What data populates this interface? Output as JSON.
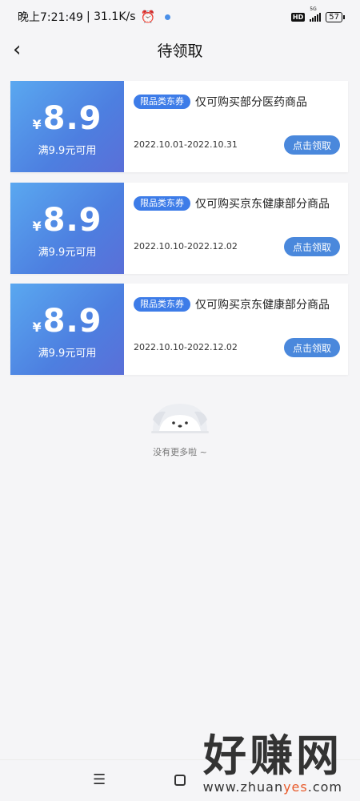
{
  "status_bar": {
    "time": "晚上7:21:49",
    "speed": "| 31.1K/s",
    "hd": "HD",
    "network": "5G",
    "battery": "57"
  },
  "header": {
    "title": "待领取"
  },
  "coupons": [
    {
      "currency": "¥",
      "amount": "8.9",
      "threshold": "满9.9元可用",
      "tag": "限品类东券",
      "description": "仅可购买部分医药商品",
      "date_range": "2022.10.01-2022.10.31",
      "button_label": "点击领取"
    },
    {
      "currency": "¥",
      "amount": "8.9",
      "threshold": "满9.9元可用",
      "tag": "限品类东券",
      "description": "仅可购买京东健康部分商品",
      "date_range": "2022.10.10-2022.12.02",
      "button_label": "点击领取"
    },
    {
      "currency": "¥",
      "amount": "8.9",
      "threshold": "满9.9元可用",
      "tag": "限品类东券",
      "description": "仅可购买京东健康部分商品",
      "date_range": "2022.10.10-2022.12.02",
      "button_label": "点击领取"
    }
  ],
  "empty_state": {
    "text": "没有更多啦 ~"
  },
  "watermark": {
    "text": "好赚网",
    "url_prefix": "www.zhuan",
    "url_highlight": "yes",
    "url_suffix": ".com"
  },
  "colors": {
    "coupon_gradient_start": "#5aa8f0",
    "coupon_gradient_end": "#5a6fd8",
    "button": "#4a88dc",
    "tag": "#3d7ce8",
    "background": "#f5f5f7"
  }
}
